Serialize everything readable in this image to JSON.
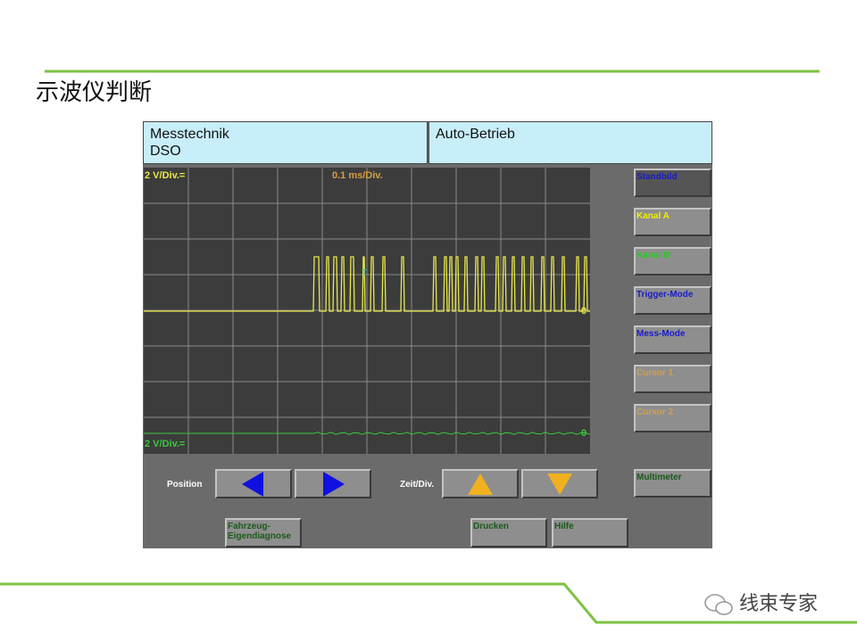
{
  "title": "示波仪判断",
  "header": {
    "mode_line1": "Messtechnik",
    "mode_line2": "DSO",
    "status": "Auto-Betrieb"
  },
  "scope": {
    "ch_a_scale": "2 V/Div.=",
    "time_scale": "0.1 ms/Div.",
    "ch_b_scale": "2 V/Div.=",
    "zero_marker_a": "0",
    "zero_marker_b": "0",
    "trigger_marker": "T"
  },
  "side_buttons": [
    {
      "label": "Standbild",
      "color": "#1a1acc"
    },
    {
      "label": "Kanal A",
      "color": "#f0f000"
    },
    {
      "label": "Kanal B",
      "color": "#22cc22"
    },
    {
      "label": "Trigger-Mode",
      "color": "#1a1acc"
    },
    {
      "label": "Mess-Mode",
      "color": "#1a1acc"
    },
    {
      "label": "Cursor 1",
      "color": "#d0a050"
    },
    {
      "label": "Cursor 2",
      "color": "#d0a050"
    },
    {
      "label": "Multimeter",
      "color": "#1a5a1a"
    }
  ],
  "bottom": {
    "position_label": "Position",
    "zeit_label": "Zeit/Div.",
    "fahrzeug": "Fahrzeug-\nEigendiagnose",
    "drucken": "Drucken",
    "hilfe": "Hilfe"
  },
  "watermark": "线束专家",
  "colors": {
    "accent_green": "#7dc242",
    "ch_a": "#e8e84a",
    "ch_b": "#3cc83c"
  }
}
